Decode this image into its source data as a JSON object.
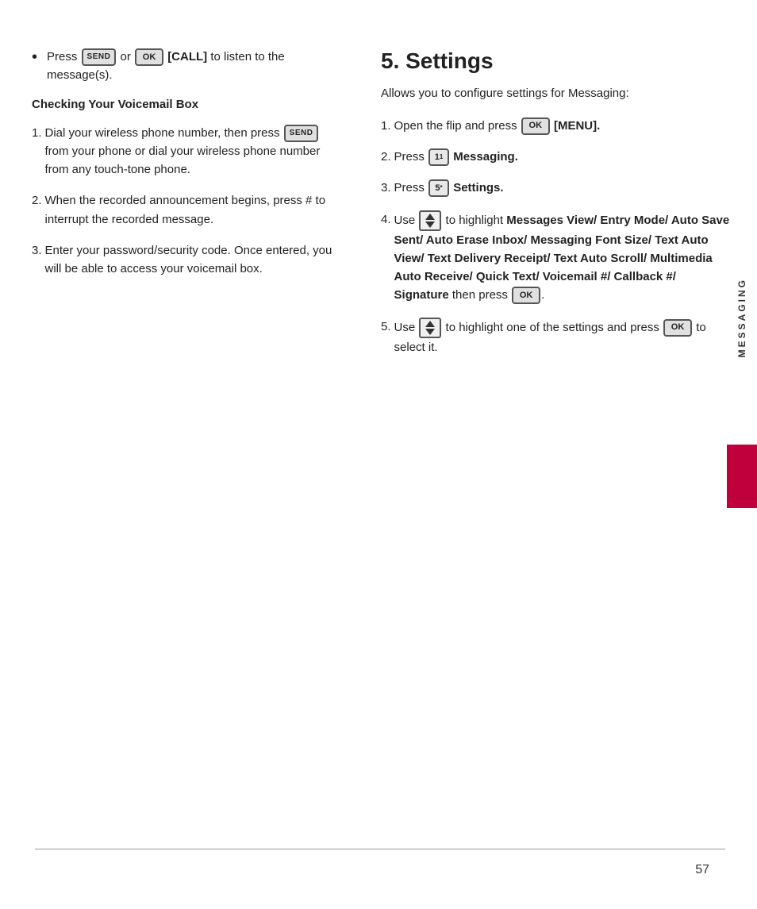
{
  "page": {
    "number": "57"
  },
  "sidebar": {
    "label": "MESSAGING"
  },
  "left": {
    "bullet": {
      "text_before": "Press",
      "btn_send": "SEND",
      "connector": "or",
      "btn_ok": "OK",
      "text_after": "[CALL] to listen to the message(s)."
    },
    "section_heading": "Checking Your Voicemail Box",
    "items": [
      {
        "num": "1.",
        "text_before": "Dial your wireless phone number, then press",
        "btn": "SEND",
        "text_after": "from your phone or dial your wireless phone number from any touch-tone phone."
      },
      {
        "num": "2.",
        "text": "When the recorded announcement begins, press # to interrupt the recorded message."
      },
      {
        "num": "3.",
        "text": "Enter your password/security code. Once entered, you will be able to access your voicemail box."
      }
    ]
  },
  "right": {
    "title": "5. Settings",
    "intro": "Allows you to configure settings for Messaging:",
    "items": [
      {
        "num": "1.",
        "text_before": "Open the flip and press",
        "btn": "OK",
        "text_bold": "[MENU].",
        "text_after": ""
      },
      {
        "num": "2.",
        "text_before": "Press",
        "btn": "1",
        "btn_sup": "1",
        "text_bold": "Messaging."
      },
      {
        "num": "3.",
        "text_before": "Press",
        "btn": "5",
        "btn_sup": "5*",
        "text_bold": "Settings."
      },
      {
        "num": "4.",
        "text_before": "Use",
        "arrow": true,
        "text_middle": "to highlight",
        "text_bold": "Messages View/ Entry Mode/ Auto Save Sent/ Auto Erase Inbox/ Messaging Font Size/ Text Auto View/ Text Delivery Receipt/ Text Auto Scroll/ Multimedia Auto Receive/ Quick Text/ Voicemail #/ Callback #/ Signature",
        "text_after": "then press",
        "btn_end": "OK",
        "text_end": "."
      },
      {
        "num": "5.",
        "text_before": "Use",
        "arrow": true,
        "text_after": "to highlight one of the settings and press",
        "btn_end": "OK",
        "text_end": "to select it."
      }
    ]
  }
}
